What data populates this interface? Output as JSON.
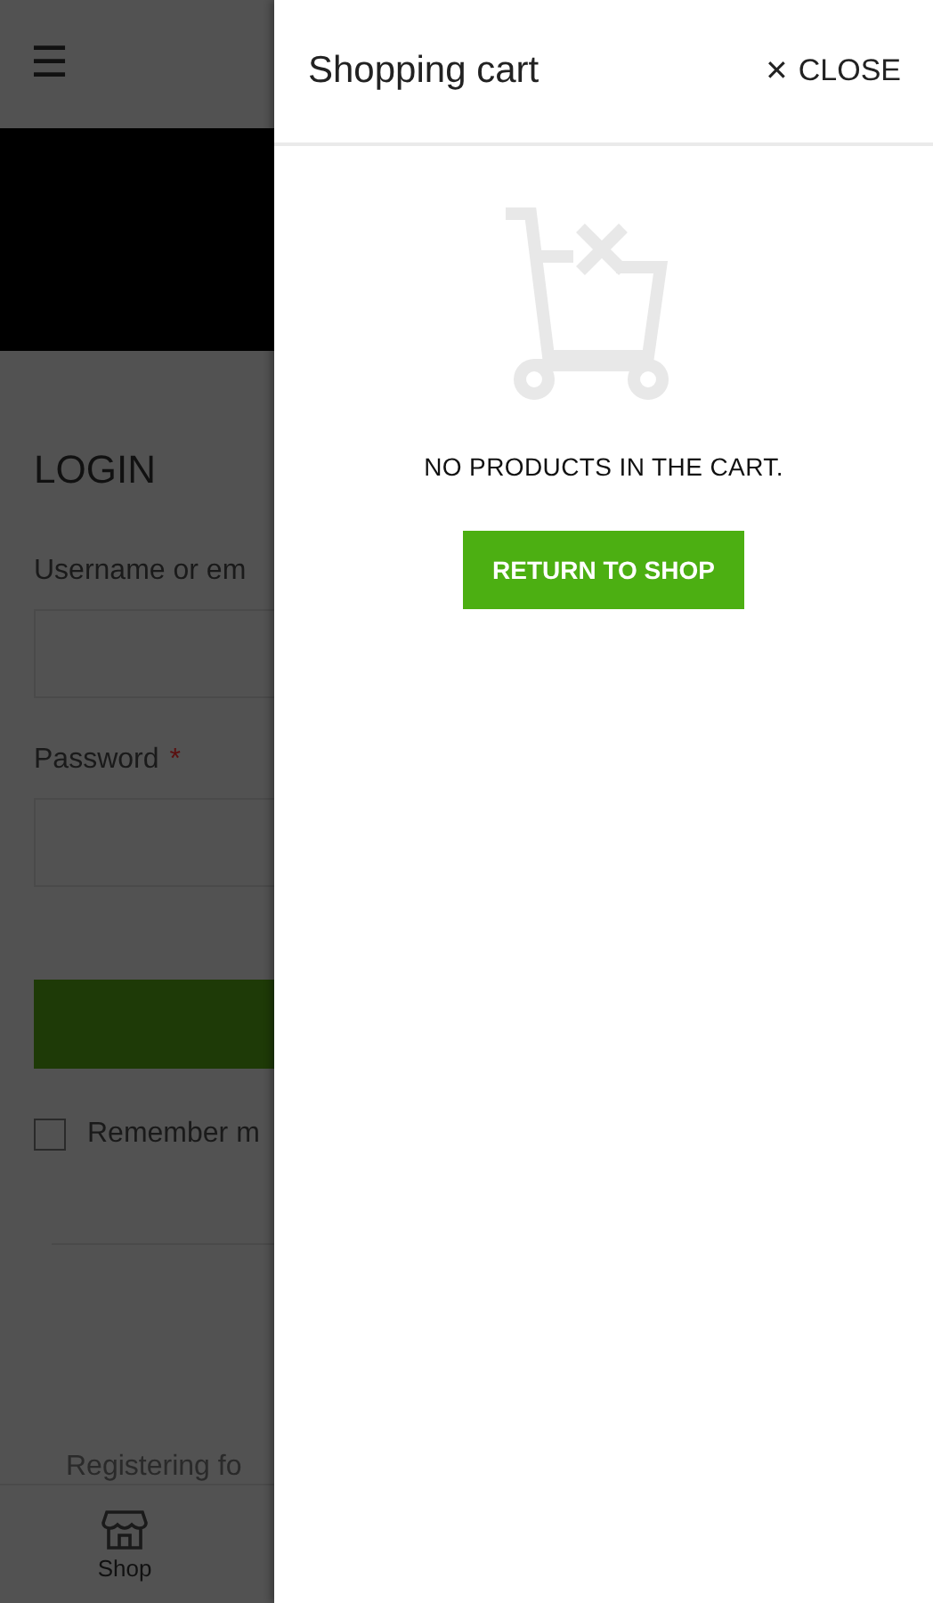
{
  "page": {
    "menu_icon": "☰",
    "login": {
      "title": "LOGIN",
      "username_label": "Username or em",
      "password_label": "Password",
      "required_mark": "*",
      "remember_label": "Remember m",
      "remember_checked": false
    },
    "registering_text": "Registering fo",
    "bottom_nav": [
      {
        "label": "Shop",
        "selected": false
      }
    ]
  },
  "cart_drawer": {
    "title": "Shopping cart",
    "close_icon": "✕",
    "close_label": "CLOSE",
    "empty_message": "NO PRODUCTS IN THE CART.",
    "return_button": "RETURN TO SHOP"
  }
}
